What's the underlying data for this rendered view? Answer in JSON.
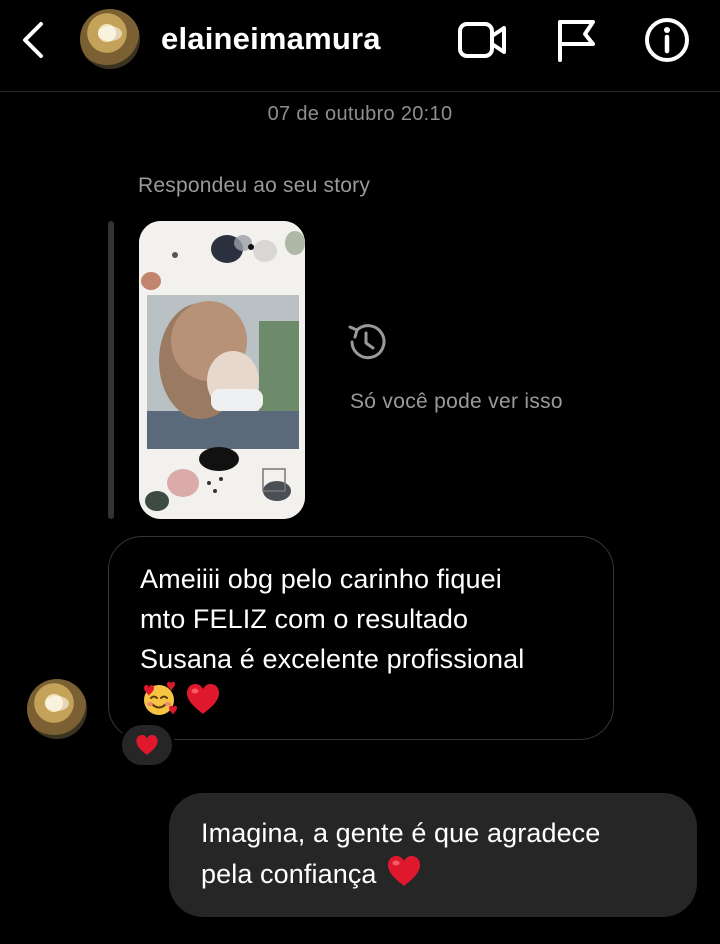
{
  "header": {
    "username": "elaineimamura",
    "icons": [
      "chevron-left-icon",
      "video-camera-icon",
      "flag-icon",
      "info-icon"
    ]
  },
  "thread": {
    "timestamp": "07 de outubro 20:10",
    "story_reply": {
      "label": "Respondeu ao seu story",
      "expired_notice": "Só você pode ver isso",
      "expired_icon": "history-icon"
    },
    "incoming": {
      "lines": [
        "Ameiiii obg pelo carinho fiquei",
        "mto FELIZ com o resultado",
        "Susana é excelente profissional"
      ],
      "emojis": [
        "smiling-face-with-hearts",
        "red-heart"
      ],
      "reaction": "red-heart"
    },
    "outgoing": {
      "lines": [
        "Imagina, a gente é que agradece",
        "pela confiança"
      ],
      "emoji": "red-heart"
    }
  },
  "colors": {
    "background": "#000000",
    "secondary_text": "#8e8e8e",
    "bubble_outgoing": "#262626",
    "bubble_incoming_border": "#363636",
    "heart": "#e0182d"
  }
}
